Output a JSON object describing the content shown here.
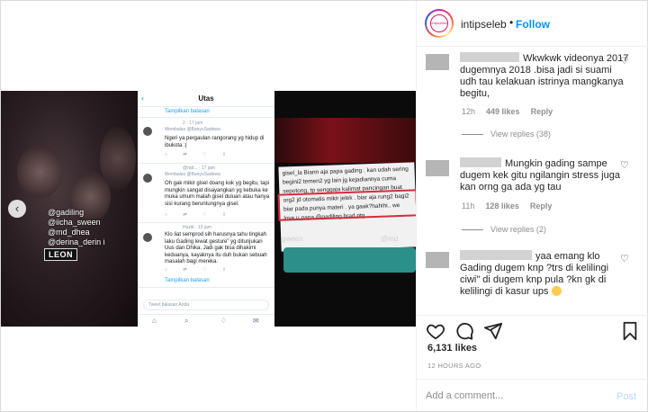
{
  "header": {
    "username": "intipseleb",
    "separator": "•",
    "follow_label": "Follow",
    "avatar_text": "intipseleb"
  },
  "media": {
    "prev_label": "‹",
    "left_panel": {
      "tags": [
        "@gadiling",
        "@iicha_sween",
        "@md_dhea",
        "@derina_derin i"
      ],
      "badge": "LEON"
    },
    "twitter": {
      "back": "‹",
      "title": "Utas",
      "show_replies": "Tampilkan balasan",
      "reply_to": "Membalas @BanyuSadewa",
      "tweets": [
        {
          "meta": "2 · 17 jam",
          "text": "Ngeri ya pergaulan rangorang yg hidup di ibukota :("
        },
        {
          "meta": "@rad... · 17 jam",
          "text": "Oh gak mikir gisel doang kok yg begitu, tapi mungkin sangat disayangkan yg kebuka ke muka umum malah gisel duluan atau hanya sisi kurang beruntungnya gisel."
        },
        {
          "meta": "Huziti · 10 jam",
          "text": "Klo liat semprod sih harusnya tahu tingkah laku Gading lewat gesture\" yg ditunjukan Uus dan Dhika. Jadi gak bisa dihakimi keduanya, kayaknya itu duh bukan sebuah masalah bagi mereka."
        }
      ],
      "show_replies_2": "Tampilkan balasan",
      "input_placeholder": "Tweet balasan Anda"
    },
    "right_panel": {
      "comment": "gisel_la Biann aja papa gading . kan udah sering begini2 temen2 yg lain jg kejadiannya cuma sepotong, tp senggaja kalimat pancingan buat org2 jd otomatis mikir jelek . biar aja rung2 bagi2 biar pada punya materi . ya gaak?hahihi.. we love u papa @gadiling brad ptg",
      "handle_left": "gween",
      "handle_right": "@md"
    }
  },
  "comments": [
    {
      "text": "Wkwkwk videonya 2017 dugemnya 2018 .bisa jadi si suami udh tau kelakuan istrinya mangkanya begitu,",
      "time": "12h",
      "likes": "449 likes",
      "reply": "Reply",
      "view_replies": "View replies (38)"
    },
    {
      "text": "Mungkin gading sampe dugem kek gitu ngilangin stress juga kan orng ga ada yg tau",
      "time": "11h",
      "likes": "128 likes",
      "reply": "Reply",
      "view_replies": "View replies (2)"
    },
    {
      "text": "yaa emang klo Gading dugem knp ?trs di kelilingi ciwi\" di dugem knp pula ?kn gk di kelilingi di kasur ups",
      "time": "",
      "likes": "",
      "reply": "",
      "view_replies": ""
    }
  ],
  "actions": {
    "likes": "6,131 likes",
    "ago": "12 HOURS AGO"
  },
  "add_comment": {
    "placeholder": "Add a comment...",
    "post_label": "Post"
  },
  "colors": {
    "accent": "#0095f6",
    "post_disabled": "#b3dbff",
    "meta": "#8e8e8e"
  },
  "icons": [
    "heart-icon",
    "comment-icon",
    "share-icon",
    "bookmark-icon",
    "chevron-left-icon"
  ]
}
